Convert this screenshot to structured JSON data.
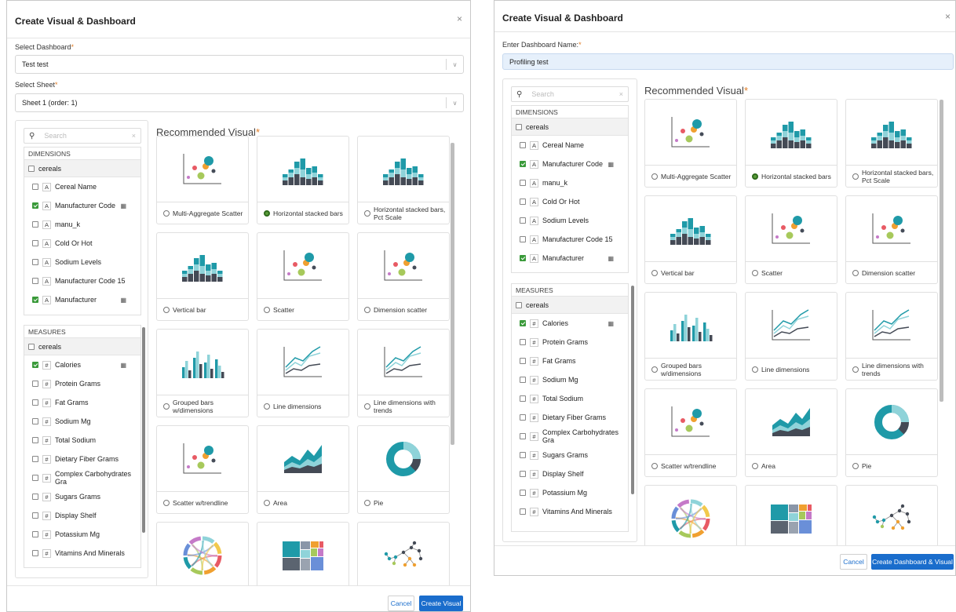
{
  "left": {
    "title": "Create Visual & Dashboard",
    "close": "×",
    "dashboard_label": "Select Dashboard",
    "dashboard_value": "Test test",
    "sheet_label": "Select Sheet",
    "sheet_value": "Sheet 1 (order: 1)",
    "recommended": "Recommended Visual",
    "cancel": "Cancel",
    "submit": "Create Visual"
  },
  "right": {
    "title": "Create Visual & Dashboard",
    "close": "×",
    "name_label": "Enter Dashboard Name:",
    "name_value": "Profiling test",
    "recommended": "Recommended Visual",
    "cancel": "Cancel",
    "submit": "Create Dashboard & Visual"
  },
  "required_mark": "*",
  "search_placeholder": "Search",
  "dimensions_header": "DIMENSIONS",
  "measures_header": "MEASURES",
  "dataset": "cereals",
  "dimensions": [
    {
      "label": "Cereal Name",
      "type": "A",
      "checked": false,
      "filter": false
    },
    {
      "label": "Manufacturer Code",
      "type": "A",
      "checked": true,
      "filter": true
    },
    {
      "label": "manu_k",
      "type": "A",
      "checked": false,
      "filter": false
    },
    {
      "label": "Cold Or Hot",
      "type": "A",
      "checked": false,
      "filter": false
    },
    {
      "label": "Sodium Levels",
      "type": "A",
      "checked": false,
      "filter": false
    },
    {
      "label": "Manufacturer Code 15",
      "type": "A",
      "checked": false,
      "filter": false
    },
    {
      "label": "Manufacturer",
      "type": "A",
      "checked": true,
      "filter": true
    }
  ],
  "measures": [
    {
      "label": "Calories",
      "type": "#",
      "checked": true,
      "filter": true
    },
    {
      "label": "Protein Grams",
      "type": "#",
      "checked": false,
      "filter": false
    },
    {
      "label": "Fat Grams",
      "type": "#",
      "checked": false,
      "filter": false
    },
    {
      "label": "Sodium Mg",
      "type": "#",
      "checked": false,
      "filter": false
    },
    {
      "label": "Total Sodium",
      "type": "#",
      "checked": false,
      "filter": false
    },
    {
      "label": "Dietary Fiber Grams",
      "type": "#",
      "checked": false,
      "filter": false
    },
    {
      "label": "Complex Carbohydrates Gra",
      "type": "#",
      "checked": false,
      "filter": false
    },
    {
      "label": "Sugars Grams",
      "type": "#",
      "checked": false,
      "filter": false
    },
    {
      "label": "Display Shelf",
      "type": "#",
      "checked": false,
      "filter": false
    },
    {
      "label": "Potassium Mg",
      "type": "#",
      "checked": false,
      "filter": false
    },
    {
      "label": "Vitamins And Minerals",
      "type": "#",
      "checked": false,
      "filter": false
    }
  ],
  "visuals": [
    {
      "label": "Multi-Aggregate Scatter",
      "icon": "scatter-multi-icon",
      "selected": false
    },
    {
      "label": "Horizontal stacked bars",
      "icon": "stacked-bars-icon",
      "selected": true
    },
    {
      "label": "Horizontal stacked bars, Pct Scale",
      "icon": "stacked-bars-pct-icon",
      "selected": false
    },
    {
      "label": "Vertical bar",
      "icon": "vertical-bar-icon",
      "selected": false
    },
    {
      "label": "Scatter",
      "icon": "scatter-icon",
      "selected": false
    },
    {
      "label": "Dimension scatter",
      "icon": "dimension-scatter-icon",
      "selected": false
    },
    {
      "label": "Grouped bars w/dimensions",
      "icon": "grouped-bars-icon",
      "selected": false
    },
    {
      "label": "Line dimensions",
      "icon": "line-icon",
      "selected": false
    },
    {
      "label": "Line dimensions with trends",
      "icon": "line-trends-icon",
      "selected": false
    },
    {
      "label": "Scatter w/trendline",
      "icon": "scatter-trend-icon",
      "selected": false
    },
    {
      "label": "Area",
      "icon": "area-icon",
      "selected": false
    },
    {
      "label": "Pie",
      "icon": "pie-icon",
      "selected": false
    },
    {
      "label": "",
      "icon": "chord-icon",
      "selected": false
    },
    {
      "label": "",
      "icon": "treemap-icon",
      "selected": false
    },
    {
      "label": "",
      "icon": "network-icon",
      "selected": false
    }
  ],
  "colors": {
    "accent": "#1a6dcc",
    "teal": "#1f9aa8",
    "dark": "#444a55",
    "light_teal": "#8fd3d9",
    "required": "#e07b24",
    "check": "#3a9a3a"
  }
}
